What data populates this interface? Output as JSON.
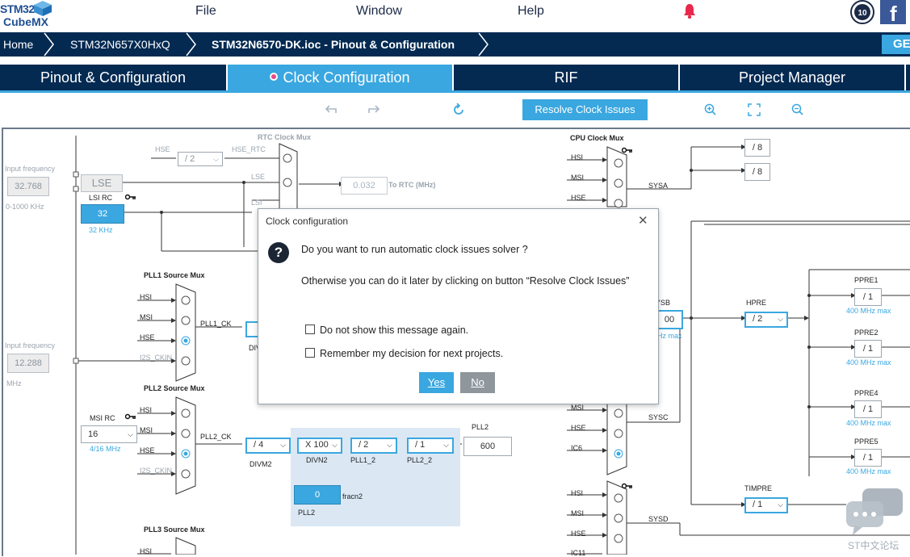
{
  "logo": {
    "line1": "STM32",
    "line2": "CubeMX"
  },
  "menu": {
    "file": "File",
    "window": "Window",
    "help": "Help"
  },
  "breadcrumb": {
    "home": "Home",
    "device": "STM32N657X0HxQ",
    "project": "STM32N6570-DK.ioc - Pinout & Configuration",
    "generate": "GE"
  },
  "tabs": {
    "pinout": "Pinout & Configuration",
    "clock": "Clock Configuration",
    "rif": "RIF",
    "project_manager": "Project Manager"
  },
  "toolbar": {
    "resolve": "Resolve Clock Issues"
  },
  "diagram": {
    "input_freq_label": "Input frequency",
    "lse_input_value": "32.768",
    "lse_range": "0-1000 KHz",
    "lse_label": "LSE",
    "lsi_rc_label": "LSI RC",
    "lsi_value": "32",
    "lsi_khz": "32 KHz",
    "hse_input_value": "12.288",
    "mhz": "MHz",
    "rtc_mux_title": "RTC Clock Mux",
    "rtc_hse": "HSE",
    "rtc_div": "/ 2",
    "hse_rtc": "HSE_RTC",
    "rtc_lse": "LSE",
    "rtc_lsi": "LSI",
    "rtc_value": "0.032",
    "to_rtc": "To RTC (MHz)",
    "cpu_mux_title": "CPU Clock Mux",
    "hsi": "HSI",
    "msi": "MSI",
    "hse": "HSE",
    "sysa": "SYSA",
    "div8_a": "/ 8",
    "div8_b": "/ 8",
    "pll1_src_title": "PLL1 Source Mux",
    "i2s_ckin": "I2S_CKIN",
    "pll1_ck": "PLL1_CK",
    "divm1_partial": "DIV",
    "pll2_src_title": "PLL2 Source Mux",
    "msi_rc_label": "MSI RC",
    "msi_value": "16",
    "msi_range": "4/16 MHz",
    "pll2_ck": "PLL2_CK",
    "divm2": "/ 4",
    "divm2_label": "DIVM2",
    "divn2": "X 100",
    "divn2_label": "DIVN2",
    "pll1_2": "/ 2",
    "pll1_2_label": "PLL1_2",
    "pll2_2": "/ 1",
    "pll2_2_label": "PLL2_2",
    "pll2_out_label": "PLL2",
    "pll2_out_value": "600",
    "fracn2_value": "0",
    "fracn2_label": "fracn2",
    "pll2_block_label": "PLL2",
    "pll3_src_title": "PLL3 Source Mux",
    "pll3_hsi": "HSI",
    "sysb_partial": "YSB",
    "sysb_value_partial": "00",
    "sysb_max_partial": "Hz max",
    "hpre_label": "HPRE",
    "hpre_value": "/ 2",
    "ppre1": "PPRE1",
    "ppre2": "PPRE2",
    "ppre4": "PPRE4",
    "ppre5": "PPRE5",
    "ppre_value": "/ 1",
    "ppre_max": "400 MHz max",
    "sysc": "SYSC",
    "ic6": "IC6",
    "sysd": "SYSD",
    "ic11_partial": "IC11",
    "timpre_label": "TIMPRE",
    "timpre_value": "/ 1"
  },
  "dialog": {
    "title": "Clock configuration",
    "question": "Do you want to run automatic clock issues solver ?",
    "detail": "Otherwise you can do it later by clicking on button “Resolve Clock Issues”",
    "dont_show": "Do not show this message again.",
    "remember": "Remember my decision for next projects.",
    "yes": "Yes",
    "no": "No"
  },
  "watermark": {
    "text": "ST中文论坛"
  },
  "colors": {
    "accent": "#3aa7e0",
    "navy": "#042a52",
    "pll_block": "#dbe8f4"
  }
}
